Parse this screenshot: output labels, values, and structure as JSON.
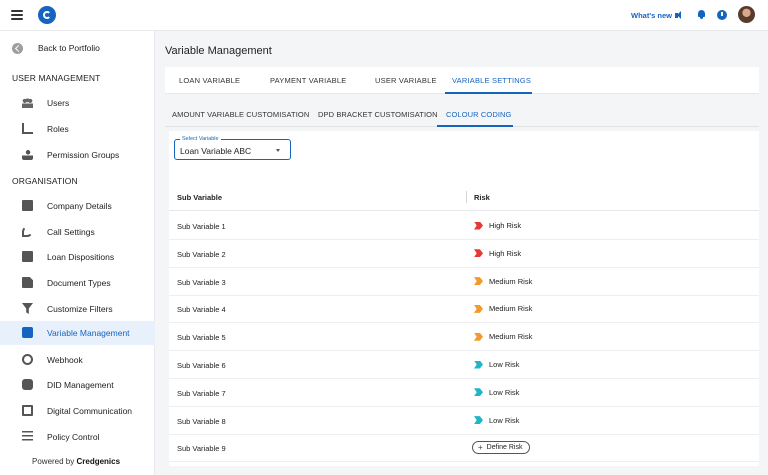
{
  "header": {
    "whats_new": "What's new",
    "icons": [
      "hamburger-icon",
      "app-logo",
      "speaker-icon",
      "bell-icon",
      "clock-icon",
      "avatar"
    ]
  },
  "sidebar": {
    "back": "Back to Portfolio",
    "section_user": "USER MANAGEMENT",
    "section_org": "ORGANISATION",
    "items": [
      {
        "label": "Users",
        "icon": "users-icon"
      },
      {
        "label": "Roles",
        "icon": "roles-icon"
      },
      {
        "label": "Permission Groups",
        "icon": "permission-groups-icon"
      },
      {
        "label": "Company Details",
        "icon": "company-details-icon"
      },
      {
        "label": "Call Settings",
        "icon": "phone-icon"
      },
      {
        "label": "Loan Dispositions",
        "icon": "loan-dispositions-icon"
      },
      {
        "label": "Document Types",
        "icon": "document-icon"
      },
      {
        "label": "Customize Filters",
        "icon": "filter-icon"
      },
      {
        "label": "Variable Management",
        "icon": "variable-icon"
      },
      {
        "label": "Webhook",
        "icon": "webhook-icon"
      },
      {
        "label": "DID Management",
        "icon": "did-icon"
      },
      {
        "label": "Digital Communication",
        "icon": "chat-icon"
      },
      {
        "label": "Policy Control",
        "icon": "sliders-icon"
      }
    ],
    "powered_prefix": "Powered by",
    "powered_brand": "Credgenics"
  },
  "main": {
    "title": "Variable Management",
    "tabs": [
      "LOAN VARIABLE",
      "PAYMENT VARIABLE",
      "USER VARIABLE",
      "VARIABLE SETTINGS"
    ],
    "active_tab": "VARIABLE SETTINGS",
    "subtabs": [
      "AMOUNT VARIABLE CUSTOMISATION",
      "DPD BRACKET CUSTOMISATION",
      "COLOUR CODING"
    ],
    "active_subtab": "COLOUR CODING",
    "select": {
      "label": "Select Variable",
      "value": "Loan Variable ABC"
    },
    "table": {
      "headers": [
        "Sub Variable",
        "Risk"
      ],
      "rows": [
        {
          "sub": "Sub Variable 1",
          "risk": "High Risk",
          "color": "#e53935"
        },
        {
          "sub": "Sub Variable 2",
          "risk": "High Risk",
          "color": "#e53935"
        },
        {
          "sub": "Sub Variable 3",
          "risk": "Medium Risk",
          "color": "#f29a2e"
        },
        {
          "sub": "Sub Variable 4",
          "risk": "Medium Risk",
          "color": "#f29a2e"
        },
        {
          "sub": "Sub Variable 5",
          "risk": "Medium Risk",
          "color": "#f29a2e"
        },
        {
          "sub": "Sub Variable 6",
          "risk": "Low Risk",
          "color": "#1fb6c8"
        },
        {
          "sub": "Sub Variable 7",
          "risk": "Low Risk",
          "color": "#1fb6c8"
        },
        {
          "sub": "Sub Variable 8",
          "risk": "Low Risk",
          "color": "#1fb6c8"
        },
        {
          "sub": "Sub Variable 9",
          "risk": "",
          "color": ""
        }
      ],
      "define_label": "Define Risk"
    }
  }
}
